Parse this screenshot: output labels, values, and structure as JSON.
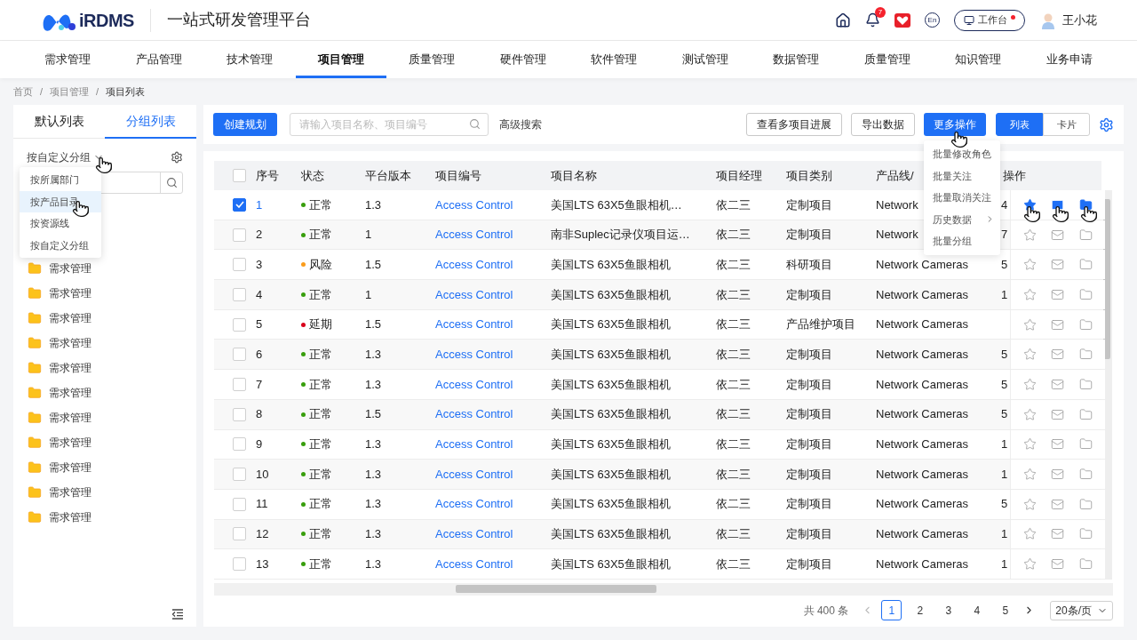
{
  "header": {
    "logo_text": "iRDMS",
    "title": "一站式研发管理平台",
    "notification_count": "7",
    "language": "En",
    "workbench": {
      "label": "工作台",
      "has_dot": true
    },
    "user": "王小花"
  },
  "nav": [
    {
      "label": "需求管理",
      "selected": false
    },
    {
      "label": "产品管理",
      "selected": false
    },
    {
      "label": "技术管理",
      "selected": false
    },
    {
      "label": "项目管理",
      "selected": true
    },
    {
      "label": "质量管理",
      "selected": false
    },
    {
      "label": "硬件管理",
      "selected": false
    },
    {
      "label": "软件管理",
      "selected": false
    },
    {
      "label": "测试管理",
      "selected": false
    },
    {
      "label": "数据管理",
      "selected": false
    },
    {
      "label": "质量管理",
      "selected": false
    },
    {
      "label": "知识管理",
      "selected": false
    },
    {
      "label": "业务申请",
      "selected": false
    }
  ],
  "breadcrumb": {
    "separator": "/",
    "items": [
      "首页",
      "项目管理",
      "项目列表"
    ]
  },
  "left_panel": {
    "tabs": [
      {
        "label": "默认列表",
        "selected": false
      },
      {
        "label": "分组列表",
        "selected": true
      }
    ],
    "group_by": "按自定义分组",
    "group_menu": [
      {
        "label": "按所属部门",
        "selected": false
      },
      {
        "label": "按产品目录",
        "selected": true
      },
      {
        "label": "按资源线",
        "selected": false
      },
      {
        "label": "按自定义分组",
        "selected": false
      }
    ],
    "folders": [
      "需求管理",
      "需求管理",
      "需求管理",
      "需求管理",
      "需求管理",
      "需求管理",
      "需求管理",
      "需求管理",
      "需求管理",
      "需求管理",
      "需求管理"
    ]
  },
  "toolbar": {
    "create_button": "创建规划",
    "search_placeholder": "请输入项目名称、项目编号",
    "advanced_search": "高级搜索",
    "buttons": [
      "查看多项目进展",
      "导出数据"
    ],
    "more_button": "更多操作",
    "view_toggle": [
      {
        "label": "列表",
        "selected": true
      },
      {
        "label": "卡片",
        "selected": false
      }
    ]
  },
  "more_menu": [
    {
      "label": "批量修改角色",
      "has_submenu": false
    },
    {
      "label": "批量关注",
      "has_submenu": false
    },
    {
      "label": "批量取消关注",
      "has_submenu": false
    },
    {
      "label": "历史数据",
      "has_submenu": true
    },
    {
      "label": "批量分组",
      "has_submenu": false
    }
  ],
  "table": {
    "select_all_checked": false,
    "columns": [
      "序号",
      "状态",
      "平台版本",
      "项目编号",
      "项目名称",
      "项目经理",
      "项目类别",
      "产品线/",
      "操作"
    ],
    "rows": [
      {
        "checked": true,
        "hovered": true,
        "number": "1",
        "status": "正常",
        "color": "#389e0d",
        "version": "1.3",
        "code": "Access Control",
        "name": "美国LTS 63X5鱼眼相机…",
        "manager": "依二三",
        "category": "定制项目",
        "product": "Network",
        "column_9": "4"
      },
      {
        "checked": false,
        "hovered": false,
        "number": "2",
        "status": "正常",
        "color": "#389e0d",
        "version": "1",
        "code": "Access Control",
        "name": "南非Suplec记录仪项目运…",
        "manager": "依二三",
        "category": "定制项目",
        "product": "Network",
        "column_9": "7"
      },
      {
        "checked": false,
        "hovered": false,
        "number": "3",
        "status": "风险",
        "color": "#fa9c1c",
        "version": "1.5",
        "code": "Access Control",
        "name": "美国LTS 63X5鱼眼相机",
        "manager": "依二三",
        "category": "科研项目",
        "product": "Network Cameras",
        "column_9": "5"
      },
      {
        "checked": false,
        "hovered": false,
        "number": "4",
        "status": "正常",
        "color": "#389e0d",
        "version": "1",
        "code": "Access Control",
        "name": "美国LTS 63X5鱼眼相机",
        "manager": "依二三",
        "category": "定制项目",
        "product": "Network Cameras",
        "column_9": "1"
      },
      {
        "checked": false,
        "hovered": false,
        "number": "5",
        "status": "延期",
        "color": "#d9001b",
        "version": "1.5",
        "code": "Access Control",
        "name": "美国LTS 63X5鱼眼相机",
        "manager": "依二三",
        "category": "产品维护项目",
        "product": "Network Cameras"
      },
      {
        "checked": false,
        "hovered": false,
        "number": "6",
        "status": "正常",
        "color": "#389e0d",
        "version": "1.3",
        "code": "Access Control",
        "name": "美国LTS 63X5鱼眼相机",
        "manager": "依二三",
        "category": "定制项目",
        "product": "Network Cameras",
        "column_9": "5"
      },
      {
        "checked": false,
        "hovered": false,
        "number": "7",
        "status": "正常",
        "color": "#389e0d",
        "version": "1.3",
        "code": "Access Control",
        "name": "美国LTS 63X5鱼眼相机",
        "manager": "依二三",
        "category": "定制项目",
        "product": "Network Cameras",
        "column_9": "5"
      },
      {
        "checked": false,
        "hovered": false,
        "number": "8",
        "status": "正常",
        "color": "#389e0d",
        "version": "1.5",
        "code": "Access Control",
        "name": "美国LTS 63X5鱼眼相机",
        "manager": "依二三",
        "category": "定制项目",
        "product": "Network Cameras",
        "column_9": "5"
      },
      {
        "checked": false,
        "hovered": false,
        "number": "9",
        "status": "正常",
        "color": "#389e0d",
        "version": "1.3",
        "code": "Access Control",
        "name": "美国LTS 63X5鱼眼相机",
        "manager": "依二三",
        "category": "定制项目",
        "product": "Network Cameras",
        "column_9": "1"
      },
      {
        "checked": false,
        "hovered": false,
        "number": "10",
        "status": "正常",
        "color": "#389e0d",
        "version": "1.3",
        "code": "Access Control",
        "name": "美国LTS 63X5鱼眼相机",
        "manager": "依二三",
        "category": "定制项目",
        "product": "Network Cameras",
        "column_9": "1"
      },
      {
        "checked": false,
        "hovered": false,
        "number": "11",
        "status": "正常",
        "color": "#389e0d",
        "version": "1.3",
        "code": "Access Control",
        "name": "美国LTS 63X5鱼眼相机",
        "manager": "依二三",
        "category": "定制项目",
        "product": "Network Cameras",
        "column_9": "5"
      },
      {
        "checked": false,
        "hovered": false,
        "number": "12",
        "status": "正常",
        "color": "#389e0d",
        "version": "1.3",
        "code": "Access Control",
        "name": "美国LTS 63X5鱼眼相机",
        "manager": "依二三",
        "category": "定制项目",
        "product": "Network Cameras",
        "column_9": "1"
      },
      {
        "checked": false,
        "hovered": false,
        "number": "13",
        "status": "正常",
        "color": "#389e0d",
        "version": "1.3",
        "code": "Access Control",
        "name": "美国LTS 63X5鱼眼相机",
        "manager": "依二三",
        "category": "定制项目",
        "product": "Network Cameras",
        "column_9": "1"
      }
    ]
  },
  "pagination": {
    "total": "共 400 条",
    "pages": [
      {
        "label": "1",
        "selected": true
      },
      {
        "label": "2",
        "selected": false
      },
      {
        "label": "3",
        "selected": false
      },
      {
        "label": "4",
        "selected": false
      },
      {
        "label": "5",
        "selected": false
      }
    ],
    "page_size": "20条/页"
  }
}
